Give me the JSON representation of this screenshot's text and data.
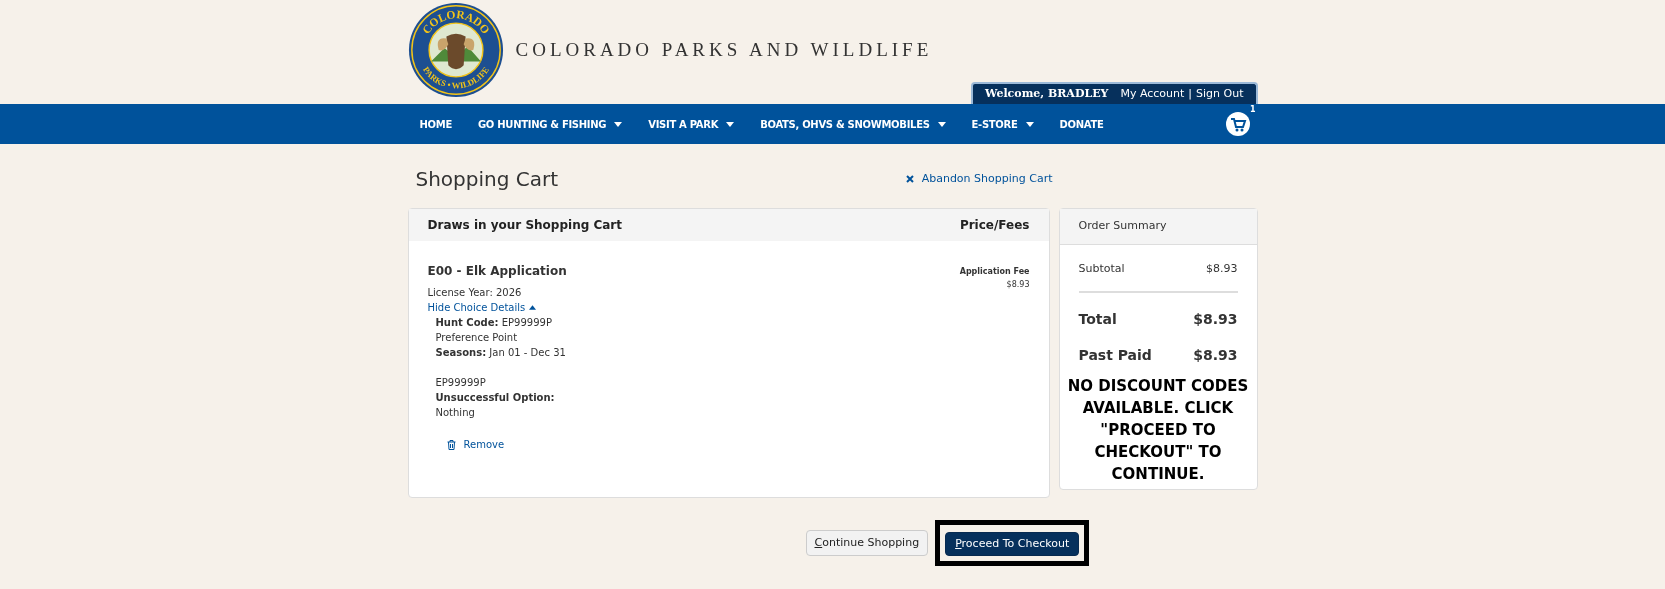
{
  "logo": {
    "top": "COLORADO",
    "bottom": "PARKS • WILDLIFE"
  },
  "site_title": "COLORADO PARKS AND WILDLIFE",
  "account_bar": {
    "welcome": "Welcome, BRADLEY",
    "links": [
      "My Account",
      "Sign Out"
    ],
    "separator": "|"
  },
  "nav": [
    {
      "label": "HOME",
      "dropdown": false
    },
    {
      "label": "GO HUNTING & FISHING",
      "dropdown": true
    },
    {
      "label": "VISIT A PARK",
      "dropdown": true
    },
    {
      "label": "BOATS, OHVS & SNOWMOBILES",
      "dropdown": true
    },
    {
      "label": "E-STORE",
      "dropdown": true
    },
    {
      "label": "DONATE",
      "dropdown": false
    }
  ],
  "cart_count": "1",
  "page_title": "Shopping Cart",
  "abandon_link": "Abandon Shopping Cart",
  "cart": {
    "header": "Draws in your Shopping Cart",
    "price_header": "Price/Fees",
    "items": [
      {
        "title": "E00 - Elk Application",
        "license_year": "License Year: 2026",
        "details_toggle": "Hide Choice Details",
        "expanded": true,
        "hunt_code_label": "Hunt Code:",
        "hunt_code": "EP99999P",
        "type": "Preference Point",
        "seasons_label": "Seasons:",
        "seasons": "Jan 01 - Dec 31",
        "code_repeat": "EP99999P",
        "unsuccessful_label": "Unsuccessful Option:",
        "unsuccessful": "Nothing",
        "fee_label": "Application Fee",
        "fee": "$8.93",
        "remove": "Remove"
      }
    ]
  },
  "summary": {
    "title": "Order Summary",
    "subtotal_label": "Subtotal",
    "subtotal": "$8.93",
    "total_label": "Total",
    "total": "$8.93",
    "paid_label": "Past Paid",
    "paid": "$8.93",
    "notice": "NO DISCOUNT CODES AVAILABLE. CLICK \"PROCEED TO CHECKOUT\" TO CONTINUE."
  },
  "buttons": [
    {
      "label": "Continue Shopping",
      "kind": "secondary"
    },
    {
      "label": "Proceed To Checkout",
      "kind": "primary"
    }
  ]
}
